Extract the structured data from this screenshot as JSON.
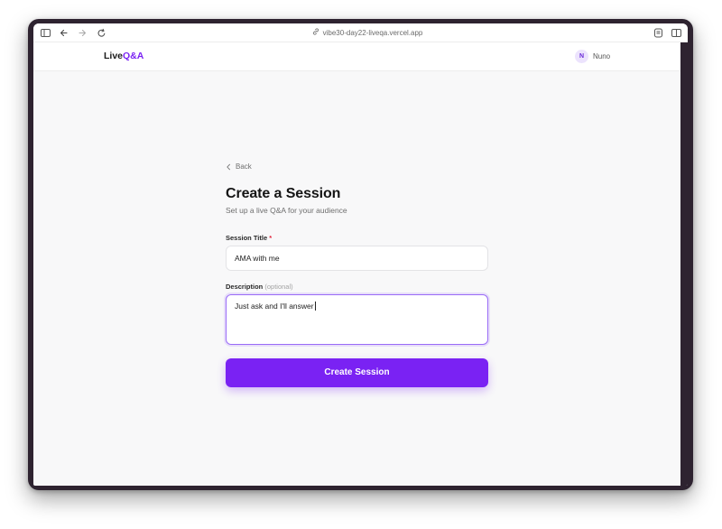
{
  "browser": {
    "url": "vibe30-day22-liveqa.vercel.app",
    "icons": [
      "sidebar-icon",
      "back-arrow-icon",
      "forward-arrow-icon",
      "reload-icon",
      "link-icon",
      "reader-icon",
      "split-view-icon"
    ]
  },
  "navbar": {
    "logo_part1": "Live",
    "logo_part2": "Q&A",
    "user_initial": "N",
    "user_name": "Nuno"
  },
  "form": {
    "back_label": "Back",
    "title": "Create a Session",
    "subtitle": "Set up a live Q&A for your audience",
    "title_field_label": "Session Title",
    "required_marker": "*",
    "title_value": "AMA with me",
    "description_label": "Description",
    "description_optional": "(optional)",
    "description_value": "Just ask and I'll answer",
    "submit_label": "Create Session"
  },
  "colors": {
    "accent": "#7a22f3",
    "required": "#e0223a",
    "window_frame": "#2e2330",
    "page_bg": "#f8f8f9"
  }
}
